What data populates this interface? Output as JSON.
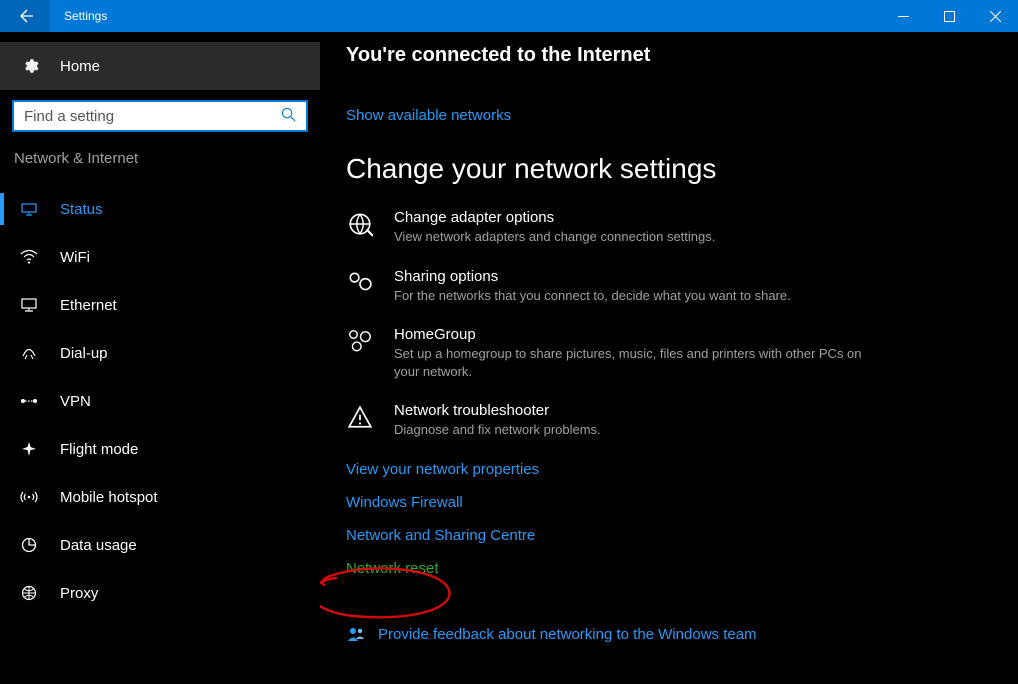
{
  "titlebar": {
    "title": "Settings"
  },
  "sidebar": {
    "home": "Home",
    "search_placeholder": "Find a setting",
    "section_label": "Network & Internet",
    "items": [
      {
        "label": "Status",
        "selected": true
      },
      {
        "label": "WiFi",
        "selected": false
      },
      {
        "label": "Ethernet",
        "selected": false
      },
      {
        "label": "Dial-up",
        "selected": false
      },
      {
        "label": "VPN",
        "selected": false
      },
      {
        "label": "Flight mode",
        "selected": false
      },
      {
        "label": "Mobile hotspot",
        "selected": false
      },
      {
        "label": "Data usage",
        "selected": false
      },
      {
        "label": "Proxy",
        "selected": false
      }
    ]
  },
  "content": {
    "connected_title": "You're connected to the Internet",
    "show_networks": "Show available networks",
    "change_heading": "Change your network settings",
    "options": [
      {
        "title": "Change adapter options",
        "desc": "View network adapters and change connection settings."
      },
      {
        "title": "Sharing options",
        "desc": "For the networks that you connect to, decide what you want to share."
      },
      {
        "title": "HomeGroup",
        "desc": "Set up a homegroup to share pictures, music, files and printers with other PCs on your network."
      },
      {
        "title": "Network troubleshooter",
        "desc": "Diagnose and fix network problems."
      }
    ],
    "links": {
      "view_props": "View your network properties",
      "firewall": "Windows Firewall",
      "sharing_centre": "Network and Sharing Centre",
      "network_reset": "Network reset"
    },
    "feedback": "Provide feedback about networking to the Windows team"
  }
}
